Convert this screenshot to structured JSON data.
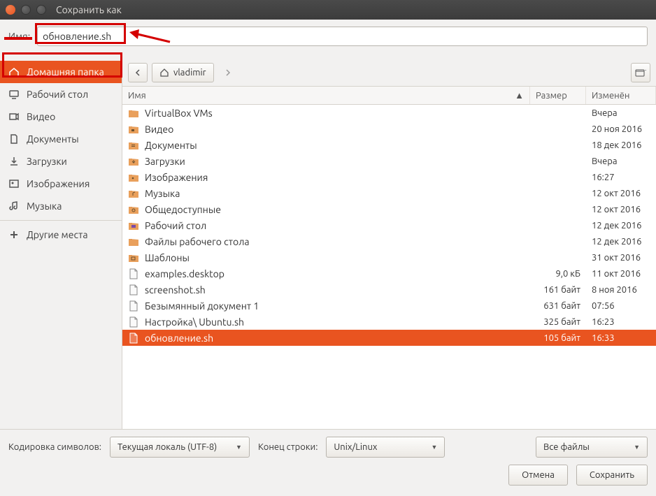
{
  "window": {
    "title": "Сохранить как"
  },
  "name_row": {
    "label": "Имя:",
    "value": "обновление.sh"
  },
  "sidebar": {
    "items": [
      {
        "label": "Домашняя папка",
        "icon": "home",
        "active": true
      },
      {
        "label": "Рабочий стол",
        "icon": "desktop"
      },
      {
        "label": "Видео",
        "icon": "video"
      },
      {
        "label": "Документы",
        "icon": "document"
      },
      {
        "label": "Загрузки",
        "icon": "download"
      },
      {
        "label": "Изображения",
        "icon": "image"
      },
      {
        "label": "Музыка",
        "icon": "music"
      }
    ],
    "other": {
      "label": "Другие места",
      "icon": "plus"
    }
  },
  "pathbar": {
    "location": "vladimir"
  },
  "columns": {
    "name": "Имя",
    "size": "Размер",
    "modified": "Изменён"
  },
  "files": [
    {
      "name": "VirtualBox VMs",
      "size": "",
      "modified": "Вчера",
      "type": "folder"
    },
    {
      "name": "Видео",
      "size": "",
      "modified": "20 ноя 2016",
      "type": "folder-video"
    },
    {
      "name": "Документы",
      "size": "",
      "modified": "18 дек 2016",
      "type": "folder-doc"
    },
    {
      "name": "Загрузки",
      "size": "",
      "modified": "Вчера",
      "type": "folder-dl"
    },
    {
      "name": "Изображения",
      "size": "",
      "modified": "16:27",
      "type": "folder-img"
    },
    {
      "name": "Музыка",
      "size": "",
      "modified": "12 окт 2016",
      "type": "folder-music"
    },
    {
      "name": "Общедоступные",
      "size": "",
      "modified": "12 окт 2016",
      "type": "folder-pub"
    },
    {
      "name": "Рабочий стол",
      "size": "",
      "modified": "12 дек 2016",
      "type": "folder-desk"
    },
    {
      "name": "Файлы рабочего стола",
      "size": "",
      "modified": "12 дек 2016",
      "type": "folder"
    },
    {
      "name": "Шаблоны",
      "size": "",
      "modified": "31 окт 2016",
      "type": "folder-tpl"
    },
    {
      "name": "examples.desktop",
      "size": "9,0 кБ",
      "modified": "11 окт 2016",
      "type": "file"
    },
    {
      "name": "screenshot.sh",
      "size": "161 байт",
      "modified": "8 ноя 2016",
      "type": "file"
    },
    {
      "name": "Безымянный документ 1",
      "size": "631 байт",
      "modified": "07:56",
      "type": "file"
    },
    {
      "name": "Настройка\\ Ubuntu.sh",
      "size": "325 байт",
      "modified": "16:23",
      "type": "file"
    },
    {
      "name": "обновление.sh",
      "size": "105 байт",
      "modified": "16:33",
      "type": "file",
      "selected": true
    }
  ],
  "bottom": {
    "encoding_label": "Кодировка символов:",
    "encoding_value": "Текущая локаль (UTF-8)",
    "eol_label": "Конец строки:",
    "eol_value": "Unix/Linux",
    "filter_value": "Все файлы",
    "cancel": "Отмена",
    "save": "Сохранить"
  }
}
